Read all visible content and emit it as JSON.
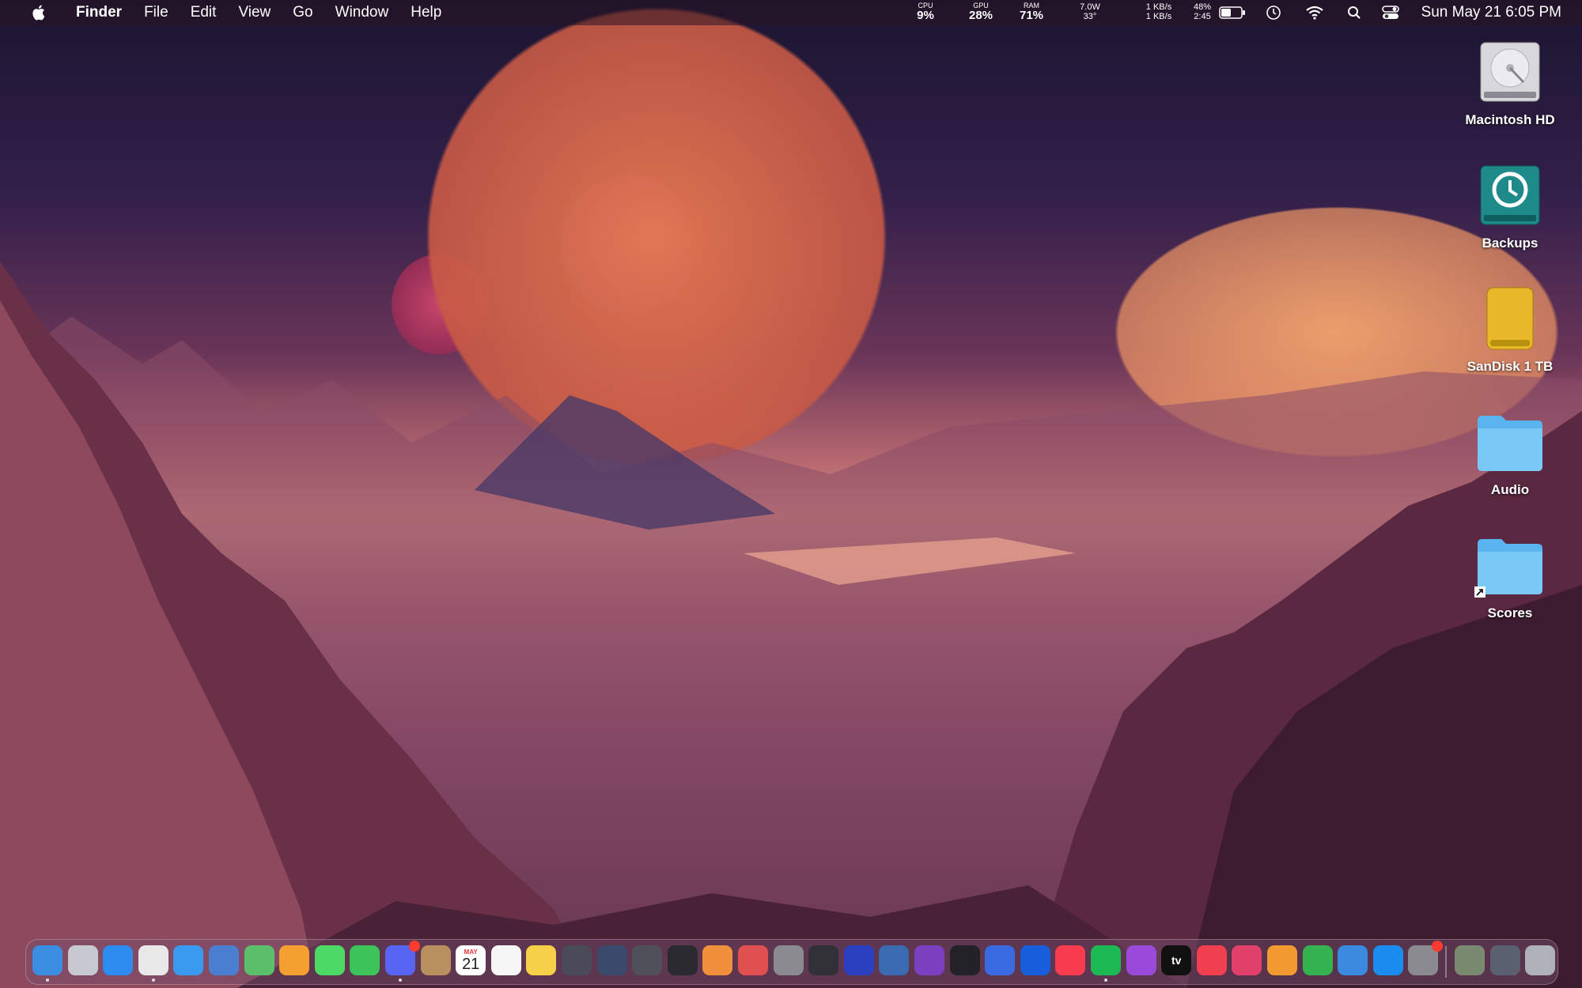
{
  "menubar": {
    "app_name": "Finder",
    "menus": [
      "File",
      "Edit",
      "View",
      "Go",
      "Window",
      "Help"
    ],
    "stats": {
      "cpu_label": "CPU",
      "cpu_value": "9%",
      "gpu_label": "GPU",
      "gpu_value": "28%",
      "ram_label": "RAM",
      "ram_value": "71%",
      "power_value": "7.0W",
      "temp_value": "33°",
      "net_up": "1 KB/s",
      "net_down": "1 KB/s",
      "battery_percent": "48%",
      "battery_time": "2:45"
    },
    "clock": "Sun May 21  6:05 PM"
  },
  "desktop": {
    "items": [
      {
        "label": "Macintosh HD",
        "icon": "hard-drive-icon"
      },
      {
        "label": "Backups",
        "icon": "time-machine-drive-icon"
      },
      {
        "label": "SanDisk 1 TB",
        "icon": "external-drive-icon"
      },
      {
        "label": "Audio",
        "icon": "folder-icon"
      },
      {
        "label": "Scores",
        "icon": "folder-alias-icon"
      }
    ]
  },
  "dock": {
    "calendar_month": "MAY",
    "calendar_day": "21",
    "tv_label": "tv",
    "apps": [
      {
        "icon": "finder-icon",
        "color": "#3a8de0"
      },
      {
        "icon": "launchpad-icon",
        "color": "#c8c8d0"
      },
      {
        "icon": "safari-icon",
        "color": "#2d8cf0"
      },
      {
        "icon": "chrome-icon",
        "color": "#e8e8e8"
      },
      {
        "icon": "mail-icon",
        "color": "#3a9af0"
      },
      {
        "icon": "files-icon",
        "color": "#4a7fd0"
      },
      {
        "icon": "maps-icon",
        "color": "#5cbf6c"
      },
      {
        "icon": "photos-icon",
        "color": "#f4a030"
      },
      {
        "icon": "messages-icon",
        "color": "#4cd964"
      },
      {
        "icon": "facetime-icon",
        "color": "#3cc35a"
      },
      {
        "icon": "discord-icon",
        "color": "#5865f2"
      },
      {
        "icon": "contacts-icon",
        "color": "#b89060"
      },
      {
        "icon": "calendar-icon",
        "color": "#ffffff"
      },
      {
        "icon": "reminders-icon",
        "color": "#f6f6f6"
      },
      {
        "icon": "notes-icon",
        "color": "#f7d04a"
      },
      {
        "icon": "davinci-resolve-icon",
        "color": "#4a4a58"
      },
      {
        "icon": "pixelmator-icon",
        "color": "#3a4a6a"
      },
      {
        "icon": "compressor-icon",
        "color": "#50505a"
      },
      {
        "icon": "obs-icon",
        "color": "#2a2a30"
      },
      {
        "icon": "blender-icon",
        "color": "#f0903a"
      },
      {
        "icon": "aperture-icon",
        "color": "#e05050"
      },
      {
        "icon": "disk-utility-icon",
        "color": "#8a8a90"
      },
      {
        "icon": "logic-icon",
        "color": "#303036"
      },
      {
        "icon": "headphones-app-icon",
        "color": "#2a40c0"
      },
      {
        "icon": "sound-app-icon",
        "color": "#3a6ab0"
      },
      {
        "icon": "music-notation-icon",
        "color": "#7a40c0"
      },
      {
        "icon": "activity-monitor-icon",
        "color": "#222228"
      },
      {
        "icon": "screens-icon",
        "color": "#3a6ae0"
      },
      {
        "icon": "bitwarden-icon",
        "color": "#175ddc"
      },
      {
        "icon": "music-icon",
        "color": "#fa3c50"
      },
      {
        "icon": "spotify-icon",
        "color": "#1db954"
      },
      {
        "icon": "podcasts-icon",
        "color": "#9a4ad8"
      },
      {
        "icon": "apple-tv-icon",
        "color": "#111111"
      },
      {
        "icon": "news-icon",
        "color": "#f04050"
      },
      {
        "icon": "waveform-icon",
        "color": "#e0406a"
      },
      {
        "icon": "pages-icon",
        "color": "#f09a30"
      },
      {
        "icon": "numbers-icon",
        "color": "#34b450"
      },
      {
        "icon": "keynote-icon",
        "color": "#3a8ae0"
      },
      {
        "icon": "app-store-icon",
        "color": "#1a8cf0"
      },
      {
        "icon": "system-settings-icon",
        "color": "#8a8a90"
      },
      {
        "icon": "downloads-stack-icon",
        "color": "#7a8a70"
      },
      {
        "icon": "window-stack-icon",
        "color": "#5a6070"
      },
      {
        "icon": "trash-icon",
        "color": "#b0b0b8"
      }
    ]
  },
  "colors": {
    "menubar_bg": "#28142380",
    "badge": "#ff3b30"
  }
}
